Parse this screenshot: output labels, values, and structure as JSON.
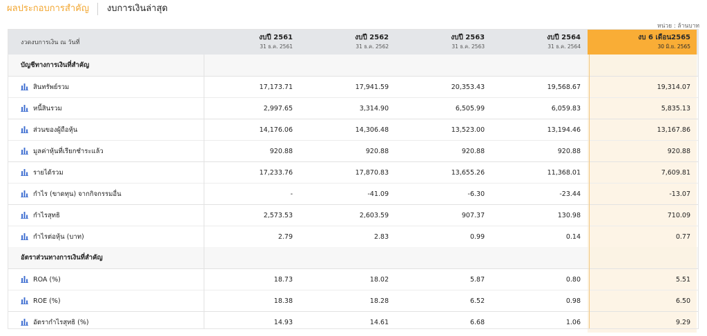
{
  "tabs": [
    {
      "label": "ผลประกอบการสำคัญ",
      "active": true
    },
    {
      "label": "งบการเงินล่าสุด",
      "active": false
    }
  ],
  "unit_note": "หน่วย : ล้านบาท",
  "table": {
    "header_label": "งวดงบการเงิน ณ วันที่",
    "columns": [
      {
        "title": "งบปี 2561",
        "date": "31 ธ.ค. 2561"
      },
      {
        "title": "งบปี 2562",
        "date": "31 ธ.ค. 2562"
      },
      {
        "title": "งบปี 2563",
        "date": "31 ธ.ค. 2563"
      },
      {
        "title": "งบปี 2564",
        "date": "31 ธ.ค. 2564"
      },
      {
        "title": "งบ 6 เดือน2565",
        "date": "30 มิ.ย. 2565"
      }
    ],
    "sections": [
      {
        "title": "บัญชีทางการเงินที่สำคัญ",
        "rows": [
          {
            "label": "สินทรัพย์รวม",
            "values": [
              "17,173.71",
              "17,941.59",
              "20,353.43",
              "19,568.67",
              "19,314.07"
            ]
          },
          {
            "label": "หนี้สินรวม",
            "values": [
              "2,997.65",
              "3,314.90",
              "6,505.99",
              "6,059.83",
              "5,835.13"
            ]
          },
          {
            "label": "ส่วนของผู้ถือหุ้น",
            "values": [
              "14,176.06",
              "14,306.48",
              "13,523.00",
              "13,194.46",
              "13,167.86"
            ]
          },
          {
            "label": "มูลค่าหุ้นที่เรียกชำระแล้ว",
            "values": [
              "920.88",
              "920.88",
              "920.88",
              "920.88",
              "920.88"
            ]
          },
          {
            "label": "รายได้รวม",
            "values": [
              "17,233.76",
              "17,870.83",
              "13,655.26",
              "11,368.01",
              "7,609.81"
            ]
          },
          {
            "label": "กำไร (ขาดทุน) จากกิจกรรมอื่น",
            "values": [
              "-",
              "-41.09",
              "-6.30",
              "-23.44",
              "-13.07"
            ]
          },
          {
            "label": "กำไรสุทธิ",
            "values": [
              "2,573.53",
              "2,603.59",
              "907.37",
              "130.98",
              "710.09"
            ]
          },
          {
            "label": "กำไรต่อหุ้น (บาท)",
            "values": [
              "2.79",
              "2.83",
              "0.99",
              "0.14",
              "0.77"
            ]
          }
        ]
      },
      {
        "title": "อัตราส่วนทางการเงินที่สำคัญ",
        "rows": [
          {
            "label": "ROA (%)",
            "values": [
              "18.73",
              "18.02",
              "5.87",
              "0.80",
              "5.51"
            ]
          },
          {
            "label": "ROE (%)",
            "values": [
              "18.38",
              "18.28",
              "6.52",
              "0.98",
              "6.50"
            ]
          },
          {
            "label": "อัตรากำไรสุทธิ (%)",
            "values": [
              "14.93",
              "14.61",
              "6.68",
              "1.06",
              "9.29"
            ]
          }
        ]
      }
    ]
  },
  "colors": {
    "accent": "#f9ad36",
    "active_tab": "#f2a630",
    "icon_blue": "#3f6fd1",
    "header_bg": "#e4e6e9",
    "highlight_col_bg": "#fdf4e6"
  },
  "icons": {
    "row_icon": "bar-chart-icon"
  }
}
